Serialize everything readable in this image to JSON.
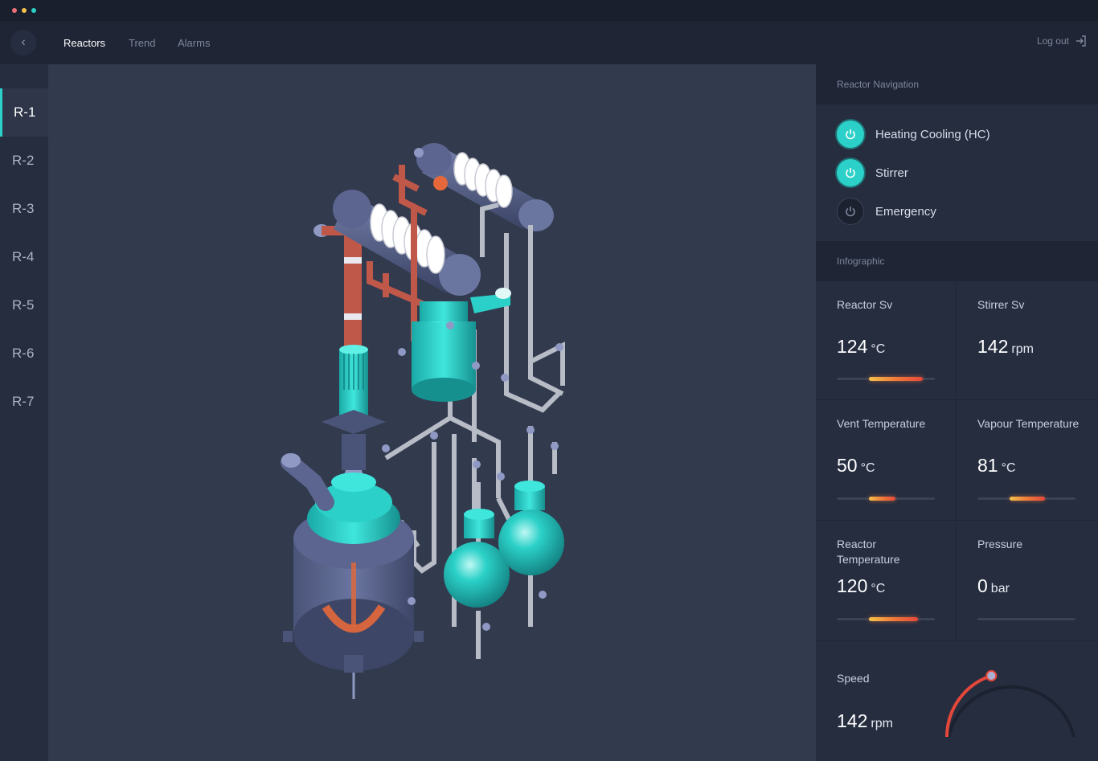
{
  "window": {
    "dots": [
      "#f0707a",
      "#f3c34a",
      "#2bd1c8"
    ]
  },
  "nav": {
    "back_icon": "chevron-left-icon",
    "tabs": [
      {
        "label": "Reactors",
        "active": true
      },
      {
        "label": "Trend",
        "active": false
      },
      {
        "label": "Alarms",
        "active": false
      }
    ],
    "logout_label": "Log out",
    "logout_icon": "logout-icon"
  },
  "sidebar": {
    "items": [
      {
        "label": "R-1",
        "active": true
      },
      {
        "label": "R-2",
        "active": false
      },
      {
        "label": "R-3",
        "active": false
      },
      {
        "label": "R-4",
        "active": false
      },
      {
        "label": "R-5",
        "active": false
      },
      {
        "label": "R-6",
        "active": false
      },
      {
        "label": "R-7",
        "active": false
      }
    ]
  },
  "reactor_navigation": {
    "title": "Reactor Navigation",
    "toggles": [
      {
        "label": "Heating Cooling (HC)",
        "on": true
      },
      {
        "label": "Stirrer",
        "on": true
      },
      {
        "label": "Emergency",
        "on": false
      }
    ]
  },
  "infographic": {
    "title": "Infographic",
    "metrics": [
      {
        "label": "Reactor Sv",
        "value": "124",
        "unit": "°C",
        "level": 0.55
      },
      {
        "label": "Stirrer Sv",
        "value": "142",
        "unit": "rpm",
        "level": null
      },
      {
        "label": "Vent Temperature",
        "value": "50",
        "unit": "°C",
        "level": 0.27
      },
      {
        "label": "Vapour Temperature",
        "value": "81",
        "unit": "°C",
        "level": 0.36
      },
      {
        "label": "Reactor Temperature",
        "value": "120",
        "unit": "°C",
        "level": 0.5
      },
      {
        "label": "Pressure",
        "value": "0",
        "unit": "bar",
        "level": 0
      }
    ],
    "speed": {
      "label": "Speed",
      "value": "142",
      "unit": "rpm",
      "level": 0.4
    }
  },
  "colors": {
    "accent": "#2bd1c8",
    "heat_start": "#f3c34a",
    "heat_end": "#e5473a",
    "vessel": "#2bd1c8",
    "pipe_hot": "#c0584a",
    "pipe": "#b8bcc7"
  }
}
